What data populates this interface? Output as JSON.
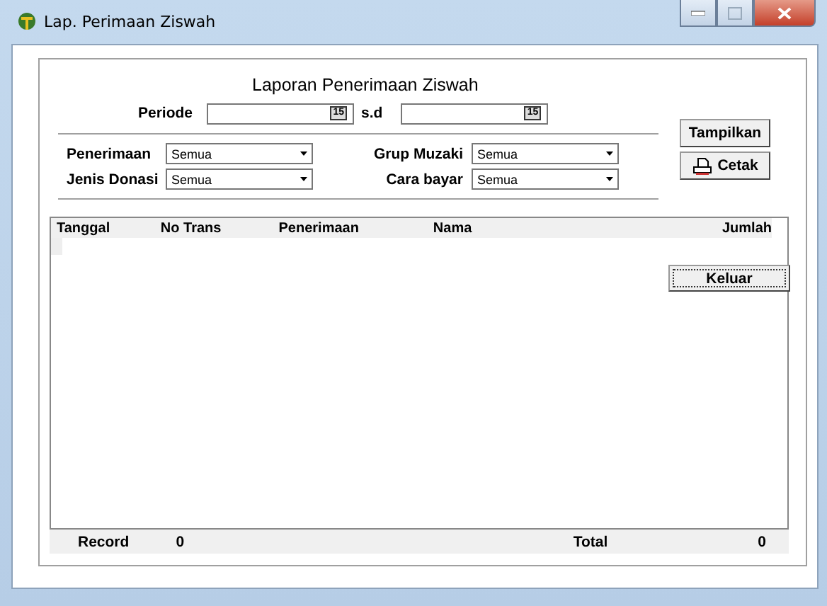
{
  "window": {
    "title": "Lap. Perimaan Ziswah"
  },
  "report_title": "Laporan Penerimaan Ziswah",
  "period": {
    "label": "Periode",
    "separator": "s.d",
    "from_calendar": "15",
    "to_calendar": "15"
  },
  "filters": [
    {
      "label": "Penerimaan",
      "value": "Semua"
    },
    {
      "label": "Grup Muzaki",
      "value": "Semua"
    },
    {
      "label": "Jenis Donasi",
      "value": "Semua"
    },
    {
      "label": "Cara bayar",
      "value": "Semua"
    }
  ],
  "buttons": {
    "show": "Tampilkan",
    "print": "Cetak",
    "exit": "Keluar"
  },
  "table": {
    "columns": [
      {
        "label": "Tanggal"
      },
      {
        "label": "No Trans"
      },
      {
        "label": "Penerimaan"
      },
      {
        "label": "Nama"
      },
      {
        "label": "Jumlah"
      }
    ]
  },
  "footer": {
    "record_label": "Record",
    "record_value": "0",
    "total_label": "Total",
    "total_value": "0"
  }
}
